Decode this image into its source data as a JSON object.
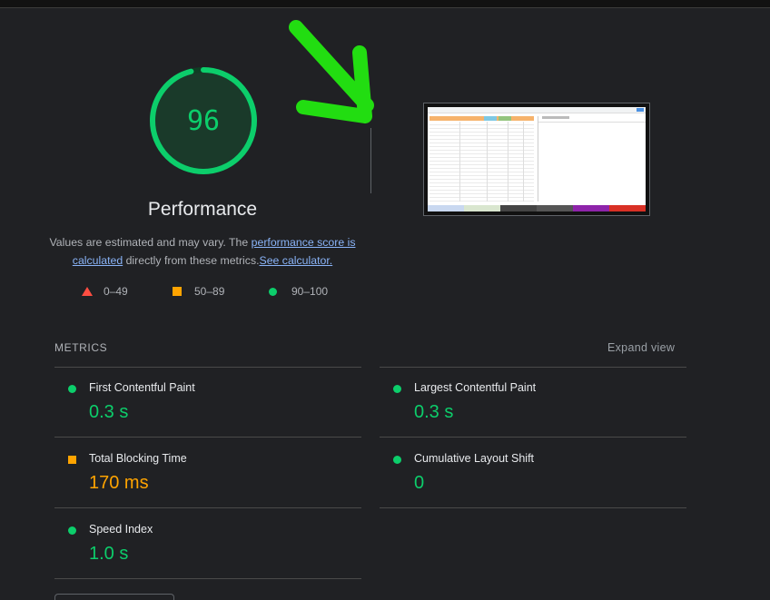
{
  "gauge": {
    "score": "96",
    "score_fraction": 0.96,
    "title": "Performance",
    "color": "#0cce6b"
  },
  "description": {
    "prefix": "Values are estimated and may vary. The ",
    "link1": "performance score is calculated",
    "middle": " directly from these metrics.",
    "link2": "See calculator."
  },
  "legend": [
    {
      "shape": "triangle-icon",
      "range": "0–49",
      "color": "#ff4e42"
    },
    {
      "shape": "square-icon",
      "range": "50–89",
      "color": "#ffa400"
    },
    {
      "shape": "circle-icon",
      "range": "90–100",
      "color": "#0cce6b"
    }
  ],
  "metrics": {
    "title": "METRICS",
    "expand_label": "Expand view",
    "items": [
      {
        "label": "First Contentful Paint",
        "value": "0.3 s",
        "status": "pass"
      },
      {
        "label": "Largest Contentful Paint",
        "value": "0.3 s",
        "status": "pass"
      },
      {
        "label": "Total Blocking Time",
        "value": "170 ms",
        "status": "average"
      },
      {
        "label": "Cumulative Layout Shift",
        "value": "0",
        "status": "pass"
      },
      {
        "label": "Speed Index",
        "value": "1.0 s",
        "status": "pass"
      }
    ]
  },
  "colors": {
    "pass": "#0cce6b",
    "average": "#ffa400",
    "fail": "#ff4e42",
    "annotation_arrow": "#22dd11"
  }
}
